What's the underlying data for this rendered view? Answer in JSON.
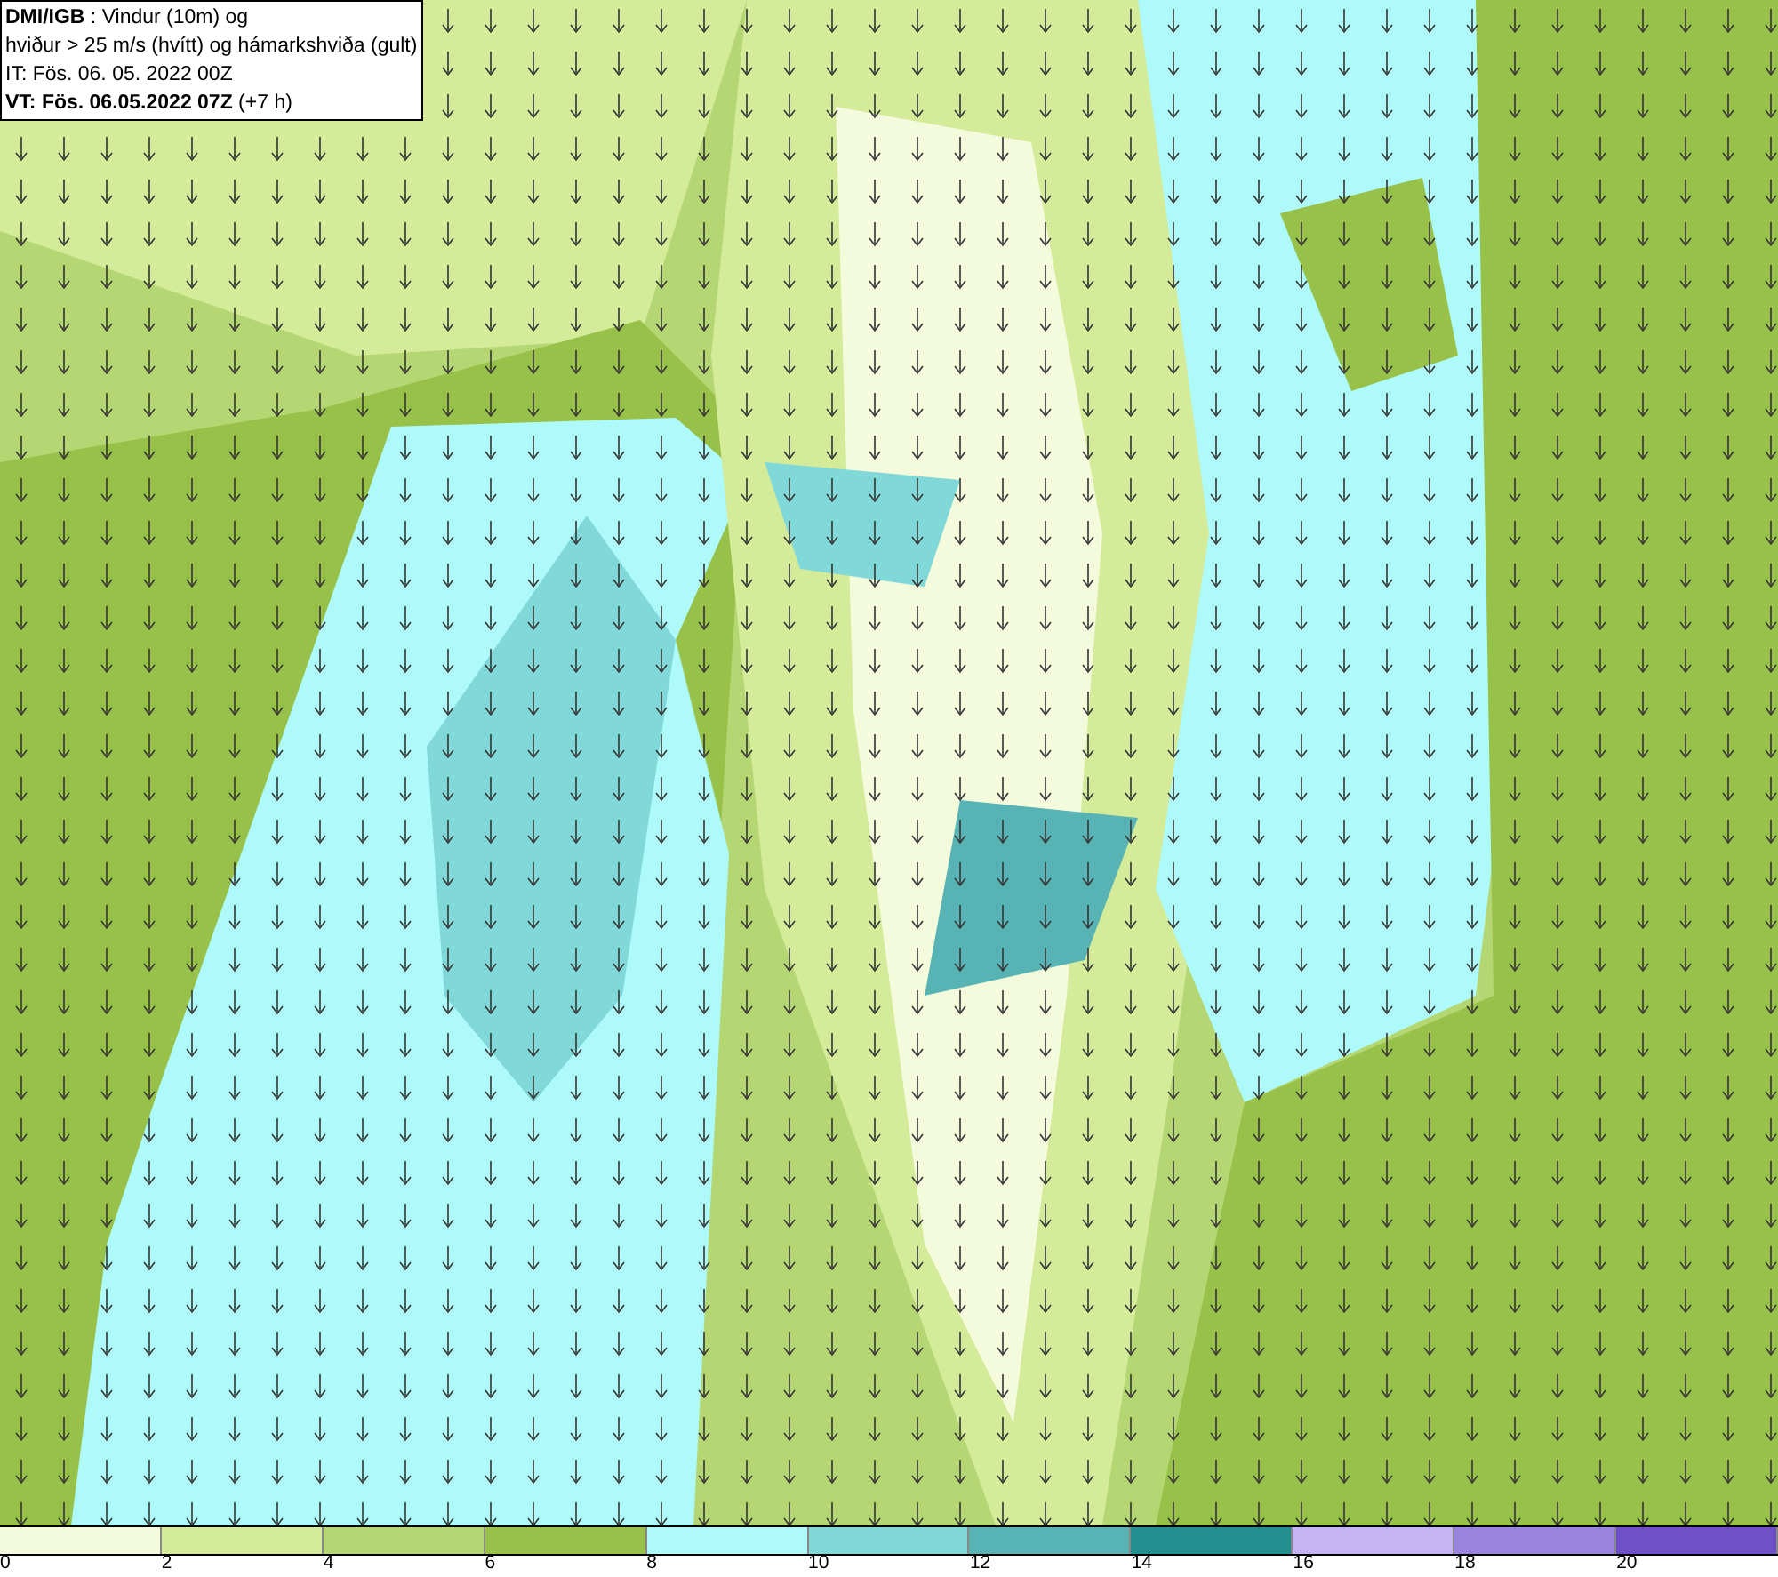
{
  "title_box": {
    "lines": [
      "**DMI/IGB** : Vindur (10m) og",
      "hviður > 25 m/s (hvítt) og hámarkshviða (gult)",
      "IT: Fös. 06. 05. 2022 00Z",
      "**VT: Fös. 06.05.2022 07Z** (+7 h)"
    ]
  },
  "legend": {
    "bins": [
      {
        "label": "0",
        "color": "#f4fadc"
      },
      {
        "label": "2",
        "color": "#d4eb9a"
      },
      {
        "label": "4",
        "color": "#b4d774"
      },
      {
        "label": "6",
        "color": "#98c14a"
      },
      {
        "label": "8",
        "color": "#aefafa"
      },
      {
        "label": "10",
        "color": "#80d8d8"
      },
      {
        "label": "12",
        "color": "#58b4b4"
      },
      {
        "label": "14",
        "color": "#239090"
      },
      {
        "label": "16",
        "color": "#c4b4f4"
      },
      {
        "label": "18",
        "color": "#9a84e0"
      },
      {
        "label": "20",
        "color": "#7050c8"
      }
    ]
  }
}
